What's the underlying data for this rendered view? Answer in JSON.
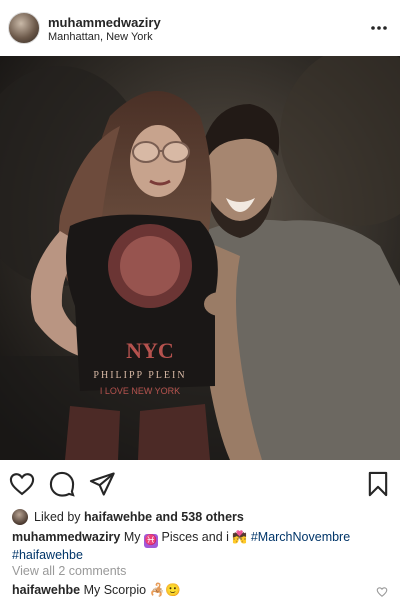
{
  "post": {
    "username": "muhammedwaziry",
    "location": "Manhattan, New York"
  },
  "photo": {
    "shirt_text_top": "NYC",
    "shirt_text_mid": "PHILIPP PLEIN",
    "shirt_text_bottom": "I LOVE NEW YORK"
  },
  "likes": {
    "prefix": "Liked by",
    "user": "haifawehbe",
    "suffix": "and 538 others"
  },
  "caption": {
    "username": "muhammedwaziry",
    "text_1": "My",
    "zodiac_symbol": "♓",
    "text_2": "Pisces and i",
    "emoji_couple": "💏",
    "hashtag_1": "#MarchNovembre",
    "hashtag_2": "#haifawehbe"
  },
  "comments_link": "View all 2 comments",
  "comment": {
    "username": "haifawehbe",
    "text": "My Scorpio",
    "emoji": "🦂🙂"
  },
  "icons": {
    "more": "more-horizontal-icon",
    "like": "heart-icon",
    "comment": "comment-bubble-icon",
    "share": "paper-plane-icon",
    "save": "bookmark-icon",
    "comment_like": "small-heart-icon"
  }
}
